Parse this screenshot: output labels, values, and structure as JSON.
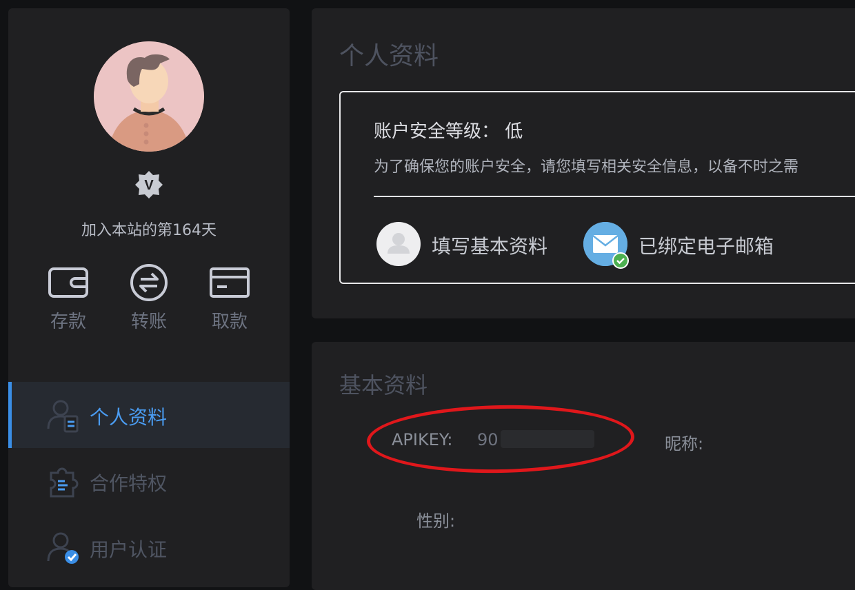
{
  "user": {
    "vip_badge_letter": "V",
    "join_days_text": "加入本站的第164天"
  },
  "quick_actions": [
    {
      "label": "存款",
      "icon": "wallet-icon"
    },
    {
      "label": "转账",
      "icon": "transfer-icon"
    },
    {
      "label": "取款",
      "icon": "card-icon"
    }
  ],
  "sidebar": {
    "items": [
      {
        "label": "个人资料",
        "icon": "profile-doc-icon",
        "active": true
      },
      {
        "label": "合作特权",
        "icon": "puzzle-icon",
        "active": false
      },
      {
        "label": "用户认证",
        "icon": "user-verified-icon",
        "active": false
      }
    ]
  },
  "profile_card": {
    "title": "个人资料",
    "security_level_text": "账户安全等级： 低",
    "security_desc": "为了确保您的账户安全，请您填写相关安全信息，以备不时之需",
    "items": [
      {
        "label": "填写基本资料",
        "icon": "user-icon"
      },
      {
        "label": "已绑定电子邮箱",
        "icon": "mail-icon",
        "verified": true
      }
    ]
  },
  "basic_card": {
    "title": "基本资料",
    "apikey_label": "APIKEY:",
    "apikey_visible": "90",
    "nickname_label": "昵称:",
    "gender_label": "性别:"
  },
  "colors": {
    "accent": "#3a8ee6",
    "annotation": "#e0171b",
    "verified": "#4cb050"
  }
}
